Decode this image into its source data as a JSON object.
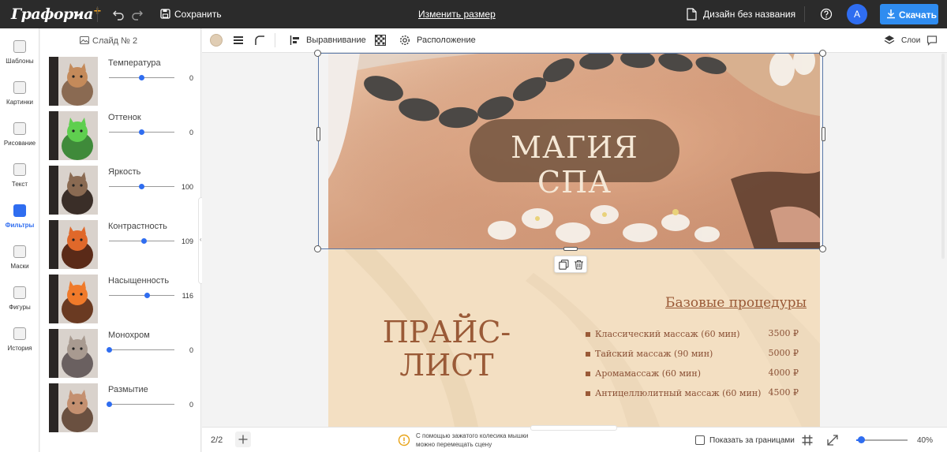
{
  "topbar": {
    "logo": "Графорна",
    "logo_plus": "+",
    "save_label": "Сохранить",
    "resize_label": "Изменить размер",
    "doc_name": "Дизайн без названия",
    "avatar_letter": "A",
    "download_label": "Скачать"
  },
  "rail": {
    "items": [
      {
        "label": "Шаблоны",
        "icon": "templates-icon"
      },
      {
        "label": "Картинки",
        "icon": "images-icon"
      },
      {
        "label": "Рисование",
        "icon": "pencil-icon"
      },
      {
        "label": "Текст",
        "icon": "text-icon"
      },
      {
        "label": "Фильтры",
        "icon": "filters-icon",
        "active": true
      },
      {
        "label": "Маски",
        "icon": "masks-icon"
      },
      {
        "label": "Фигуры",
        "icon": "shapes-icon"
      },
      {
        "label": "История",
        "icon": "history-icon"
      }
    ]
  },
  "panel": {
    "title": "Слайд № 2",
    "filters": [
      {
        "label": "Температура",
        "value": "0",
        "level": 0.5
      },
      {
        "label": "Оттенок",
        "value": "0",
        "level": 0.5
      },
      {
        "label": "Яркость",
        "value": "100",
        "level": 0.5
      },
      {
        "label": "Контрастность",
        "value": "109",
        "level": 0.54
      },
      {
        "label": "Насыщенность",
        "value": "116",
        "level": 0.58
      },
      {
        "label": "Монохром",
        "value": "0",
        "level": 0
      },
      {
        "label": "Размытие",
        "value": "0",
        "level": 0
      }
    ]
  },
  "toolbar2": {
    "align_label": "Выравнивание",
    "position_label": "Расположение",
    "layers_label": "Слои",
    "fill_color": "#e0cdb4"
  },
  "slide": {
    "hero_text": "МАГИЯ СПА",
    "pricelist_line1": "ПРАЙС-",
    "pricelist_line2": "ЛИСТ",
    "procedures_heading": "Базовые процедуры",
    "procedures": [
      {
        "name": "Классический массаж (60 мин)",
        "price": "3500 ₽"
      },
      {
        "name": "Тайский массаж (90 мин)",
        "price": "5000 ₽"
      },
      {
        "name": "Аромамассаж (60 мин)",
        "price": "4000 ₽"
      },
      {
        "name": "Антицеллюлитный массаж (60 мин)",
        "price": "4500 ₽"
      }
    ]
  },
  "bottombar": {
    "page_count": "2/2",
    "hint_line1": "С помощью зажатого колесика мышки",
    "hint_line2": "можно перемещать сцену",
    "show_bounds_label": "Показать за границами",
    "zoom": "40%",
    "zoom_level": 0.1
  }
}
